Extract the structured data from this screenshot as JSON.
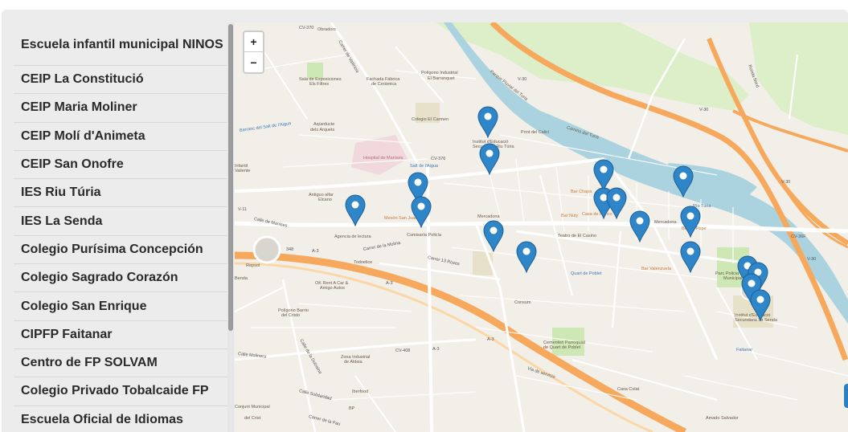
{
  "sidebar": {
    "items": [
      {
        "label": "Escuela infantil municipal NINOS"
      },
      {
        "label": "CEIP La Constitució"
      },
      {
        "label": "CEIP Maria Moliner"
      },
      {
        "label": "CEIP Molí d'Animeta"
      },
      {
        "label": "CEIP San Onofre"
      },
      {
        "label": "IES Riu Túria"
      },
      {
        "label": "IES La Senda"
      },
      {
        "label": "Colegio Purísima Concepción"
      },
      {
        "label": "Colegio Sagrado Corazón"
      },
      {
        "label": "Colegio San Enrique"
      },
      {
        "label": "CIPFP Faitanar"
      },
      {
        "label": "Centro de FP SOLVAM"
      },
      {
        "label": "Colegio Privado Tobalcaide FP"
      },
      {
        "label": "Escuela Oficial de Idiomas"
      }
    ]
  },
  "zoom": {
    "in_label": "+",
    "out_label": "−"
  },
  "map": {
    "colors": {
      "river": "#aad3df",
      "highway": "#f6a85c",
      "park": "#cde8b4",
      "road": "#ffffff",
      "land": "#f2efe9",
      "marker": "#2e86c9"
    },
    "labels": {
      "obradors": "Obradors",
      "carrer_valencia": "Carrer de València",
      "sala_exposiciones": "Sala de Exposiciones",
      "els_filtres": "Els Filtres",
      "fachada_fabrica": "Fachada Fábrica",
      "de_ceramica": "de Cerámica",
      "poligono_barranquet": "Polígono Industrial",
      "el_barranquet": "El Barranquet",
      "parque_fluvial": "Parque Fluvial del Turia",
      "camino_turia": "Camino del Turia",
      "colegio_carmen": "Colegio El Carmen",
      "aqueducte": "Aqüeducte",
      "dels_arquets": "dels Arquets",
      "barranc": "Barranc del Salt de l'Aigua",
      "hospital": "Hospital de Manises",
      "salt_aigua": "Salt de l'Aigua",
      "pont_calici": "Pont del Calici",
      "parque_turia": "Parque Natural del Turia",
      "instituto_riu": "Institut d'Educació",
      "secundaria_riu": "Secundària Riu Túria",
      "bar_chapa": "Bar Chapa",
      "bar_nuty": "Bar Nuty",
      "casa_perico": "Casa de Perico",
      "mercadona_1": "Mercadona",
      "mercadona_2": "Mercadona",
      "bar_pepe": "Bar de Pepe",
      "antiguo_alfar": "Antiguo alfar",
      "elcano": "Elcano",
      "infantil_valiente": "Infantil",
      "infantil_valiente2": "Valiente",
      "meson": "Mesón San Juan",
      "comisaria": "Comisaría Policía",
      "calle_manises": "Calle de Manises",
      "agencia": "Agencia de lectura",
      "carrer_molina": "Carrer de la Molina",
      "carrer_13_roses": "Carrer 13 Roses",
      "teatro": "Teatro de El Casino",
      "todoelice": "Todoelice",
      "repsol": "Repsol",
      "ok_rent": "OK Rent A Car &",
      "amigo_autos": "Amigo Autos",
      "benda": "Benda",
      "poligono_cristo": "Polígono Barrio",
      "del_cristo": "del Cristo",
      "quart_poblet": "Quart de Poblet",
      "bar_valenzuela": "Bar Valenzuela",
      "consum": "Consum",
      "parc_policia": "Parc Policia",
      "municipal": "Municipal",
      "instituto_senda": "Institut d'Educació",
      "secundaria_senda": "Secundària La Senda",
      "faitanar": "Faitanar",
      "cementeri": "Cementeri Parroquial",
      "de_quart": "de Quart de Poblet",
      "via_servicio": "Vía de servicio",
      "zona_industrial": "Zona Industrial",
      "de_aldaia": "de Aldaia",
      "calle_solidaridad": "Calle Solidaridad",
      "iberfood": "Iberfood",
      "bp": "BP",
      "carrer_pau": "Carrer de la Pau",
      "amado_salvador": "Amado Salvador",
      "casa_colat": "Casa Colat",
      "rio_turia": "Río Túria",
      "calle_molinera": "Calle Molinera",
      "calle_dulzaina": "Calle de la Dulzaina",
      "conj_municipal": "Conjunt Municipal",
      "de_cristo": "del Crist",
      "ronda_nord": "Ronda Nord",
      "cv_370": "CV-370",
      "cv_376": "CV-376",
      "v_30a": "V-30",
      "v_30b": "V-30",
      "v_30c": "V-30",
      "v_30d": "V-30",
      "v_11": "V-11",
      "cv_36f": "CV-36F",
      "cv_408": "CV-408",
      "a3a": "A-3",
      "a3b": "A-3",
      "a3c": "A-3",
      "a3d": "A-3",
      "n348": "348"
    },
    "markers": [
      {
        "name": "marker-riu-turia-1"
      },
      {
        "name": "marker-riu-turia-2"
      },
      {
        "name": "marker-salt-aigua"
      },
      {
        "name": "marker-meson"
      },
      {
        "name": "marker-agencia"
      },
      {
        "name": "marker-mercadona"
      },
      {
        "name": "marker-carrer-13-roses"
      },
      {
        "name": "marker-bar-chapa"
      },
      {
        "name": "marker-casa-perico-1"
      },
      {
        "name": "marker-casa-perico-2"
      },
      {
        "name": "marker-mercadona-east"
      },
      {
        "name": "marker-rio-turia"
      },
      {
        "name": "marker-bar-pepe"
      },
      {
        "name": "marker-bar-valenzuela"
      },
      {
        "name": "marker-parc-1"
      },
      {
        "name": "marker-parc-2"
      },
      {
        "name": "marker-parc-3"
      },
      {
        "name": "marker-parc-4"
      }
    ]
  }
}
